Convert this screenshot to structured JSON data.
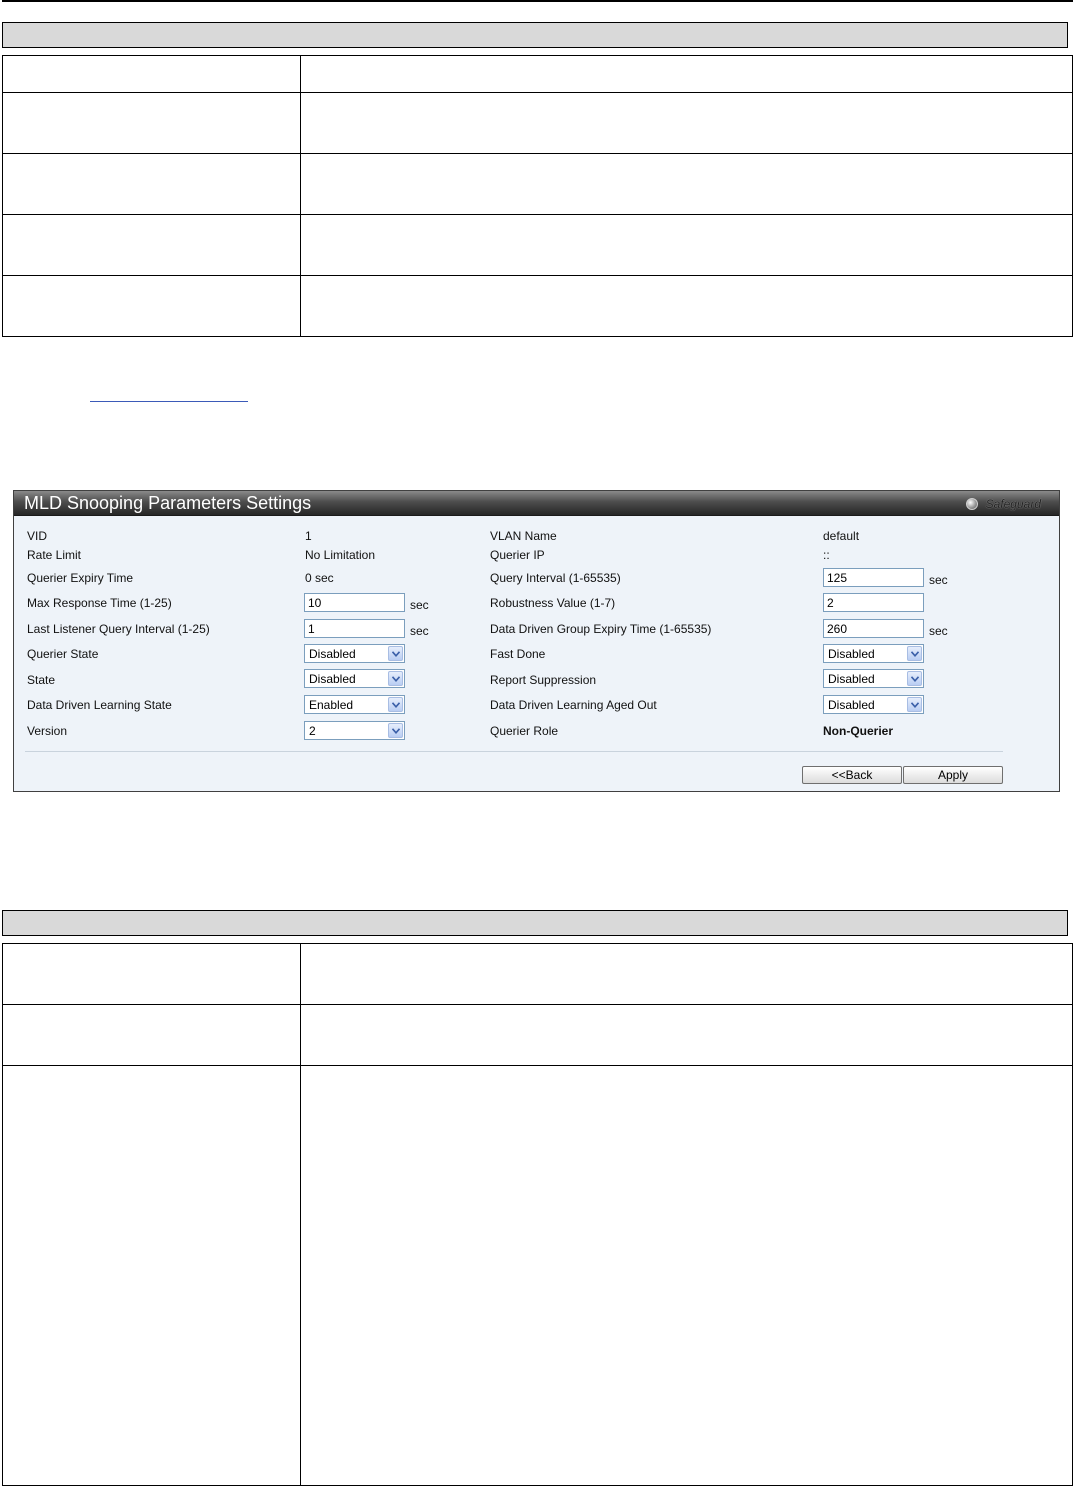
{
  "panel": {
    "title": "MLD Snooping Parameters Settings",
    "safeguard": "Safeguard",
    "left_rows": [
      {
        "label": "VID",
        "value": "1"
      },
      {
        "label": "Rate Limit",
        "value": "No Limitation"
      },
      {
        "label": "Querier Expiry Time",
        "value": "0 sec"
      },
      {
        "label": "Max Response Time (1-25)",
        "input": "10",
        "unit": "sec"
      },
      {
        "label": "Last Listener Query Interval (1-25)",
        "input": "1",
        "unit": "sec"
      },
      {
        "label": "Querier State",
        "select": "Disabled"
      },
      {
        "label": "State",
        "select": "Disabled"
      },
      {
        "label": "Data Driven Learning State",
        "select": "Enabled"
      },
      {
        "label": "Version",
        "select": "2"
      }
    ],
    "right_rows": [
      {
        "label": "VLAN Name",
        "value": "default"
      },
      {
        "label": "Querier IP",
        "value": "::"
      },
      {
        "label": "Query Interval (1-65535)",
        "input": "125",
        "unit": "sec"
      },
      {
        "label": "Robustness Value (1-7)",
        "input": "2"
      },
      {
        "label": "Data Driven Group Expiry Time (1-65535)",
        "input": "260",
        "unit": "sec"
      },
      {
        "label": "Fast Done",
        "select": "Disabled"
      },
      {
        "label": "Report Suppression",
        "select": "Disabled"
      },
      {
        "label": "Data Driven Learning Aged Out",
        "select": "Disabled"
      },
      {
        "label": "Querier Role",
        "value": "Non-Querier"
      }
    ],
    "back_label": "<<Back",
    "apply_label": "Apply"
  },
  "colors": {
    "title_bar": "#4d4d4d",
    "panel_bg": "#eef3f9",
    "table_header": "#d9d9d9",
    "input_border": "#7b9ebd"
  },
  "icons": {
    "safeguard": "safeguard-indicator-icon",
    "dropdown": "chevron-down-icon"
  }
}
